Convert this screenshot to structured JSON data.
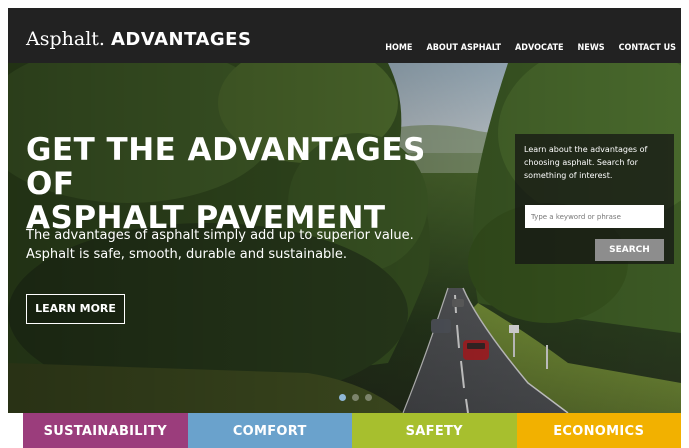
{
  "header": {
    "logo_main": "Asphalt.",
    "logo_accent": "ADVANTAGES",
    "nav": [
      "HOME",
      "ABOUT ASPHALT",
      "ADVOCATE",
      "NEWS",
      "CONTACT US"
    ]
  },
  "hero": {
    "headline_line1": "GET THE ADVANTAGES OF",
    "headline_line2": "ASPHALT PAVEMENT",
    "subtext_line1": "The advantages of asphalt simply add up to superior value.",
    "subtext_line2": "Asphalt is safe, smooth, durable and sustainable.",
    "learn_more_label": "LEARN MORE",
    "slides": {
      "count": 3,
      "active_index": 0
    }
  },
  "search": {
    "intro": "Learn about the advantages of choosing asphalt. Search for something of interest.",
    "placeholder": "Type a keyword or phrase",
    "value": "",
    "button_label": "SEARCH"
  },
  "categories": [
    {
      "label": "SUSTAINABILITY",
      "color": "#9b3d7c"
    },
    {
      "label": "COMFORT",
      "color": "#6aa2cc"
    },
    {
      "label": "SAFETY",
      "color": "#a7bf2e"
    },
    {
      "label": "ECONOMICS",
      "color": "#f2b100"
    }
  ],
  "colors": {
    "header_bg": "#222222",
    "search_button": "#8d8d8d",
    "active_dot": "#8fb7d6"
  }
}
